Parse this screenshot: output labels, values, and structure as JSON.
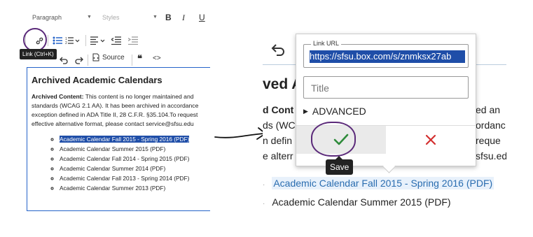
{
  "left_editor": {
    "format_select": "Paragraph",
    "styles_select": "Styles",
    "bold": "B",
    "italic": "I",
    "underline": "U",
    "link_tooltip": "Link (Ctrl+K)",
    "source_label": "Source",
    "heading": "Archived Academic Calendars",
    "archived_label": "Archived Content:",
    "para_lines": [
      " This content is no longer maintained and",
      "standards (WCAG 2.1 AA). It has been archived in accordance",
      "exception defined in ADA Title II, 28 C.F.R. §35.104.To request",
      "effective alternative format, please contact service@sfsu.edu"
    ],
    "list_items": [
      "Academic Calendar Fall 2015 - Spring 2016 (PDF)",
      "Academic Calendar Summer 2015 (PDF)",
      "Academic Calendar Fall 2014 - Spring 2015 (PDF)",
      "Academic Calendar Summer 2014 (PDF)",
      "Academic Calendar Fall 2013 - Spring 2014 (PDF)",
      "Academic Calendar Summer 2013 (PDF)"
    ]
  },
  "right_editor": {
    "heading_partial": "ved A",
    "para_lines": [
      "d Cont",
      "ds (WC",
      "n defin",
      "e alterr"
    ],
    "para_right": [
      "ed an",
      "ordanc",
      " reque",
      "sfsu.ed"
    ],
    "list_items": [
      "Academic Calendar Fall 2015 - Spring 2016 (PDF)",
      "Academic Calendar Summer 2015 (PDF)"
    ]
  },
  "link_dialog": {
    "url_label": "Link URL",
    "url_value": "https://sfsu.box.com/s/znmksx27ab",
    "title_placeholder": "Title",
    "advanced_label": "ADVANCED",
    "save_tooltip": "Save"
  },
  "colors": {
    "accent": "#1f4ea8",
    "annotation": "#5b2a7a",
    "save_check": "#2e8b3a",
    "cancel_x": "#d32f2f"
  }
}
